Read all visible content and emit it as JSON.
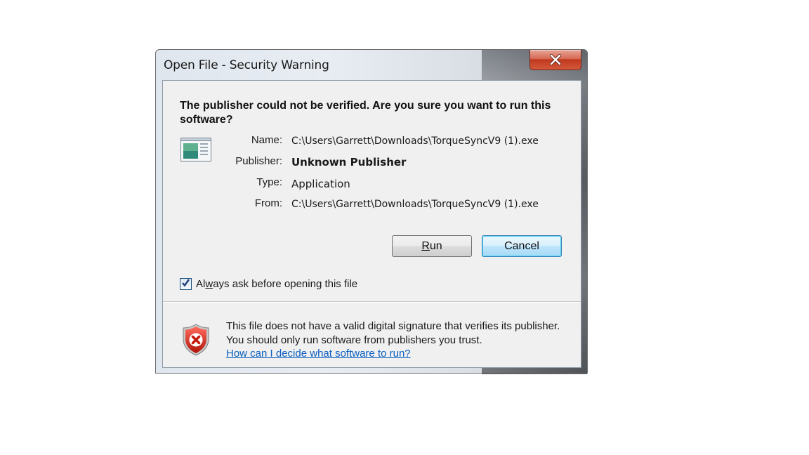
{
  "window": {
    "title": "Open File - Security Warning"
  },
  "question": "The publisher could not be verified.  Are you sure you want to run this software?",
  "fields": [
    {
      "label": "Name:",
      "value": "C:\\Users\\Garrett\\Downloads\\TorqueSyncV9 (1).exe"
    },
    {
      "label": "Publisher:",
      "value": "Unknown Publisher"
    },
    {
      "label": "Type:",
      "value": "Application"
    },
    {
      "label": "From:",
      "value": "C:\\Users\\Garrett\\Downloads\\TorqueSyncV9 (1).exe"
    }
  ],
  "buttons": {
    "run_prefix": "",
    "run_mnemonic": "R",
    "run_rest": "un",
    "cancel": "Cancel"
  },
  "checkbox": {
    "checked": true,
    "label_prefix": "Al",
    "label_mnemonic": "w",
    "label_rest": "ays ask before opening this file"
  },
  "warning": {
    "text": "This file does not have a valid digital signature that verifies its publisher.  You should only run software from publishers you trust.",
    "link": "How can I decide what software to run?"
  },
  "icons": {
    "close": "close-icon",
    "app": "application-icon",
    "shield": "security-shield-error-icon",
    "check": "checkmark-icon"
  }
}
